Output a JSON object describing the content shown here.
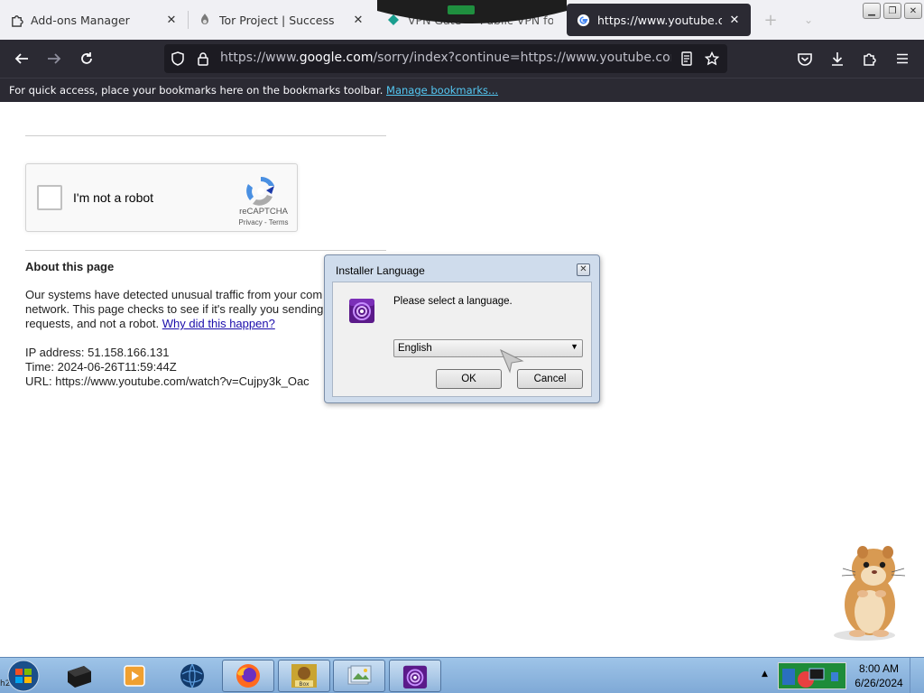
{
  "browser": {
    "tabs": [
      {
        "title": "Add-ons Manager",
        "icon": "puzzle-icon",
        "active": false
      },
      {
        "title": "Tor Project | Success",
        "icon": "onion-icon",
        "active": false
      },
      {
        "title": "VPN Gate — Public VPN for ...",
        "icon": "diamond-icon",
        "active": false
      },
      {
        "title": "https://www.youtube.com/w",
        "icon": "google-icon",
        "active": true
      }
    ],
    "close_glyph": "✕",
    "new_tab_glyph": "+",
    "window_controls": [
      "minimize",
      "restore",
      "close"
    ],
    "url_prefix": "https://www.",
    "url_domain": "google.com",
    "url_rest": "/sorry/index?continue=https://www.youtube.com/watch%",
    "bookmarks_bar_text": "For quick access, place your bookmarks here on the bookmarks toolbar.",
    "bookmarks_bar_link": "Manage bookmarks..."
  },
  "page": {
    "recaptcha": {
      "label": "I'm not a robot",
      "brand": "reCAPTCHA",
      "links": "Privacy - Terms"
    },
    "about_title": "About this page",
    "about_line1": "Our systems have detected unusual traffic from your com",
    "about_line2": "network. This page checks to see if it's really you sending",
    "about_line3": "requests, and not a robot. ",
    "about_link": "Why did this happen?",
    "ip": "IP address: 51.158.166.131",
    "time": "Time: 2024-06-26T11:59:44Z",
    "url": "URL: https://www.youtube.com/watch?v=Cujpy3k_Oac"
  },
  "dialog": {
    "title": "Installer Language",
    "close_glyph": "✕",
    "prompt": "Please select a language.",
    "selected_language": "English",
    "ok_label": "OK",
    "cancel_label": "Cancel"
  },
  "taskbar": {
    "ghost_text": "h2 ww",
    "items": [
      "terminal-icon",
      "media-player-icon",
      "globe-icon",
      "firefox-icon",
      "sandbox-icon",
      "image-viewer-icon",
      "tor-installer-icon"
    ],
    "tray_arrow": "▲",
    "time": "8:00 AM",
    "date": "6/26/2024"
  },
  "colors": {
    "chrome_dark": "#2b2a33",
    "link_blue": "#1a0dab",
    "bookmark_link": "#54c8f3",
    "taskbar": "#9ec4e8"
  }
}
